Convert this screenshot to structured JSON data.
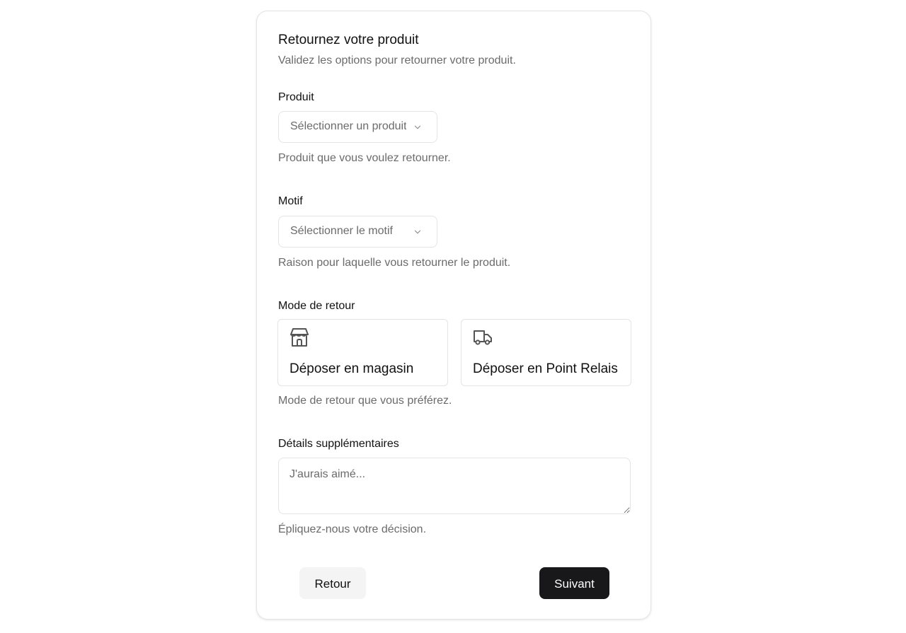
{
  "form": {
    "title": "Retournez votre produit",
    "subtitle": "Validez les options pour retourner votre produit."
  },
  "product": {
    "label": "Produit",
    "placeholder": "Sélectionner un produit",
    "help": "Produit que vous voulez retourner."
  },
  "reason": {
    "label": "Motif",
    "placeholder": "Sélectionner le motif",
    "help": "Raison pour laquelle vous retourner le produit."
  },
  "return_mode": {
    "label": "Mode de retour",
    "options": [
      {
        "label": "Déposer en magasin",
        "icon": "store-icon"
      },
      {
        "label": "Déposer en Point Relais",
        "icon": "truck-icon"
      }
    ],
    "help": "Mode de retour que vous préférez."
  },
  "details": {
    "label": "Détails supplémentaires",
    "placeholder": "J'aurais aimé...",
    "help": "Épliquez-nous votre décision."
  },
  "actions": {
    "back_label": "Retour",
    "next_label": "Suivant"
  },
  "colors": {
    "primary_button": "#18181b",
    "secondary_button": "#f4f4f5",
    "muted_text": "#6b6b6b",
    "border": "#e4e4e7"
  }
}
